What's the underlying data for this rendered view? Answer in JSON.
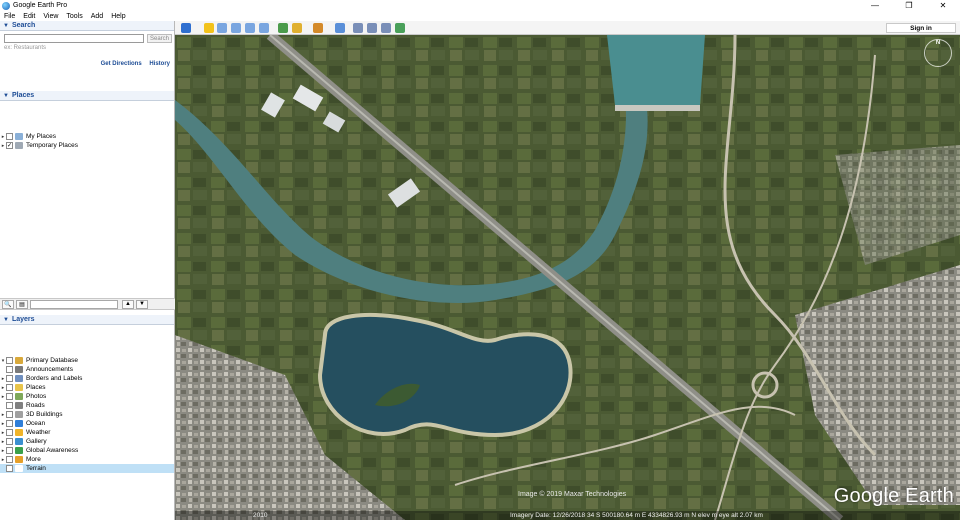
{
  "window": {
    "title": "Google Earth Pro",
    "controls": [
      "—",
      "❐",
      "✕"
    ]
  },
  "menu": [
    "File",
    "Edit",
    "View",
    "Tools",
    "Add",
    "Help"
  ],
  "search": {
    "header": "Search",
    "placeholder": "",
    "button": "Search",
    "hint": "ex: Restaurants",
    "directions": "Get Directions",
    "history": "History"
  },
  "places": {
    "header": "Places",
    "items": [
      {
        "label": "My Places",
        "checked": false
      },
      {
        "label": "Temporary Places",
        "checked": true
      }
    ]
  },
  "layers": {
    "header": "Layers",
    "items": [
      {
        "label": "Primary Database",
        "expander": "▾",
        "icon_color": "#d9a93b"
      },
      {
        "label": "Announcements",
        "expander": "",
        "icon_color": "#7a7a7a"
      },
      {
        "label": "Borders and Labels",
        "expander": "▸",
        "icon_color": "#6f8fbf"
      },
      {
        "label": "Places",
        "expander": "▸",
        "icon_color": "#e8c44a"
      },
      {
        "label": "Photos",
        "expander": "▸",
        "icon_color": "#7ea85a"
      },
      {
        "label": "Roads",
        "expander": "",
        "icon_color": "#808080"
      },
      {
        "label": "3D Buildings",
        "expander": "▸",
        "icon_color": "#a0a0a0"
      },
      {
        "label": "Ocean",
        "expander": "▸",
        "icon_color": "#2f7ed8"
      },
      {
        "label": "Weather",
        "expander": "▸",
        "icon_color": "#f0b429"
      },
      {
        "label": "Gallery",
        "expander": "▸",
        "icon_color": "#3a8fd0"
      },
      {
        "label": "Global Awareness",
        "expander": "▸",
        "icon_color": "#3aa04a"
      },
      {
        "label": "More",
        "expander": "▸",
        "icon_color": "#e5a02a"
      },
      {
        "label": "Terrain",
        "expander": "",
        "icon_color": "#ffffff"
      }
    ]
  },
  "toolbar": {
    "sign_in": "Sign in",
    "button_icons": [
      "sidebar-icon",
      "placemark-icon",
      "polygon-icon",
      "path-icon",
      "overlay-icon",
      "tour-icon",
      "historical-imagery-icon",
      "sun-icon",
      "planets-icon",
      "ruler-icon",
      "email-icon",
      "print-icon",
      "save-image-icon",
      "maps-icon"
    ]
  },
  "map": {
    "compass_label": "N",
    "copyright": "Image © 2019 Maxar Technologies",
    "logo": "Google Earth",
    "status_year": "2010",
    "status_coords": "Imagery Date: 12/26/2018     34 S 500180.64 m E 4334826.93 m N  elev     m     eye alt  2.07 km"
  }
}
